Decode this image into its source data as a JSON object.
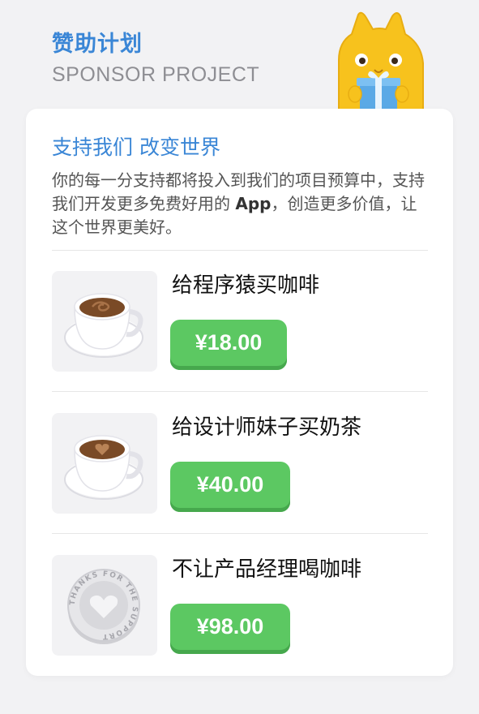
{
  "header": {
    "title": "赞助计划",
    "subtitle": "SPONSOR PROJECT"
  },
  "intro": {
    "title": "支持我们 改变世界",
    "body_before": "你的每一分支持都将投入到我们的项目预算中，支持我们开发更多免费好用的 ",
    "body_app": "App",
    "body_after": "，创造更多价值，让这个世界更美好。"
  },
  "items": [
    {
      "label": "给程序猿买咖啡",
      "price": "¥18.00",
      "image": "coffee-cup-swirl"
    },
    {
      "label": "给设计师妹子买奶茶",
      "price": "¥40.00",
      "image": "coffee-cup-heart"
    },
    {
      "label": "不让产品经理喝咖啡",
      "price": "¥98.00",
      "image": "thanks-coin"
    }
  ],
  "coin_text": "THANKS FOR THE SUPPORT",
  "colors": {
    "accent": "#3a86d6",
    "button": "#5cc862",
    "background": "#f2f2f4"
  }
}
